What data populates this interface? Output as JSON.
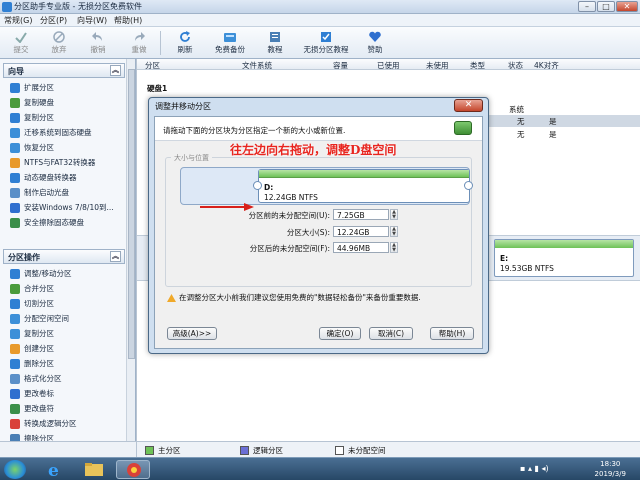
{
  "window": {
    "title": "分区助手专业版 - 无损分区免费软件"
  },
  "menu": [
    "常规(G)",
    "分区(P)",
    "向导(W)",
    "帮助(H)"
  ],
  "toolbar": [
    {
      "label": "提交",
      "icon": "submit-icon",
      "disabled": true
    },
    {
      "label": "放弃",
      "icon": "discard-icon",
      "disabled": true
    },
    {
      "label": "撤销",
      "icon": "undo-icon",
      "disabled": true
    },
    {
      "label": "重做",
      "icon": "redo-icon",
      "disabled": true
    },
    {
      "label": "刷新",
      "icon": "refresh-icon",
      "disabled": false
    },
    {
      "label": "免费备份",
      "icon": "backup-icon",
      "disabled": false
    },
    {
      "label": "教程",
      "icon": "tutorial-icon",
      "disabled": false
    },
    {
      "label": "无损分区教程",
      "icon": "lossless-tutorial-icon",
      "disabled": false
    },
    {
      "label": "赞助",
      "icon": "sponsor-heart-icon",
      "disabled": false
    }
  ],
  "wizard_panel": {
    "title": "向导",
    "items": [
      "扩展分区",
      "复制硬盘",
      "复制分区",
      "迁移系统到固态硬盘",
      "恢复分区",
      "NTFS与FAT32转换器",
      "动态硬盘转换器",
      "制作启动光盘",
      "安装Windows 7/8/10到...",
      "安全擦除固态硬盘"
    ]
  },
  "ops_panel": {
    "title": "分区操作",
    "items": [
      "调整/移动分区",
      "合并分区",
      "切割分区",
      "分配空闲空间",
      "复制分区",
      "创建分区",
      "删除分区",
      "格式化分区",
      "更改卷标",
      "更改盘符",
      "转换成逻辑分区",
      "擦除分区"
    ]
  },
  "table": {
    "columns": [
      "分区",
      "文件系统",
      "容量",
      "已使用",
      "未使用",
      "类型",
      "状态",
      "4K对齐"
    ],
    "disk_label": "硬盘1",
    "row_values": [
      {
        "status": "系统",
        "align": ""
      },
      {
        "status": "无",
        "align": "是"
      },
      {
        "status": "无",
        "align": "是"
      }
    ]
  },
  "disk_map": {
    "drive": "E:",
    "size": "19.53GB NTFS"
  },
  "legend": [
    "主分区",
    "逻辑分区",
    "未分配空间"
  ],
  "dialog": {
    "title": "调整并移动分区",
    "close": "✕",
    "instruction": "请拖动下面的分区块为分区指定一个新的大小或新位置.",
    "group_label": "大小与位置",
    "partition_drive": "D:",
    "partition_size": "12.24GB NTFS",
    "annotation": "往左边向右拖动，调整D盘空间",
    "fields": [
      {
        "label": "分区前的未分配空间(U):",
        "value": "7.25GB"
      },
      {
        "label": "分区大小(S):",
        "value": "12.24GB"
      },
      {
        "label": "分区后的未分配空间(F):",
        "value": "44.96MB"
      }
    ],
    "warning": "在调整分区大小前我们建议您使用免费的\"数据轻松备份\"来备份重要数据.",
    "buttons": {
      "advanced": "高级(A)>>",
      "ok": "确定(O)",
      "cancel": "取消(C)",
      "help": "帮助(H)"
    }
  },
  "taskbar": {
    "time": "18:30",
    "date": "2019/3/9"
  },
  "colors": {
    "accent": "#2f7fd3",
    "partition_green": "#6ec257",
    "logical": "#6b6fd6",
    "annotation_red": "#e8251f"
  }
}
